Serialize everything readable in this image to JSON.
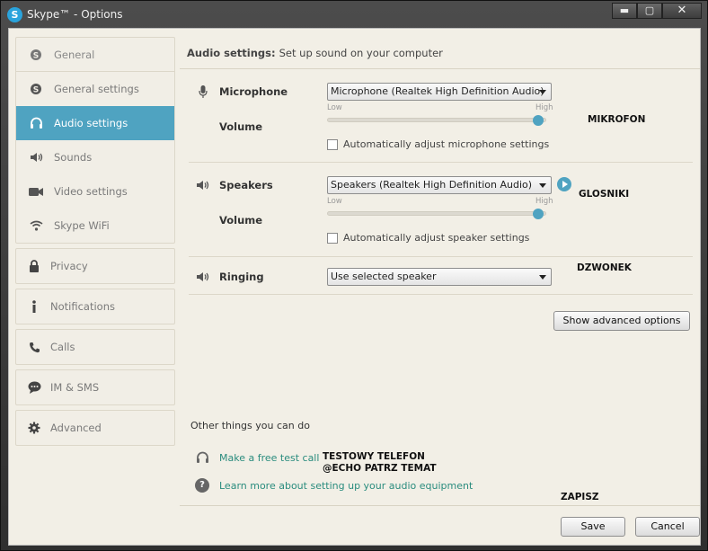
{
  "window": {
    "title": "Skype™ - Options",
    "app_icon_letter": "S",
    "minimize": "▬",
    "maximize": "▢",
    "close": "✕"
  },
  "sidebar": {
    "general_group": {
      "head": "General",
      "items": [
        {
          "label": "General settings",
          "icon": "skype-icon"
        },
        {
          "label": "Audio settings",
          "icon": "headset-icon",
          "active": true
        },
        {
          "label": "Sounds",
          "icon": "speaker-icon"
        },
        {
          "label": "Video settings",
          "icon": "camera-icon"
        },
        {
          "label": "Skype WiFi",
          "icon": "wifi-icon"
        }
      ]
    },
    "privacy": "Privacy",
    "notifications": "Notifications",
    "calls": "Calls",
    "im_sms": "IM & SMS",
    "advanced": "Advanced"
  },
  "main": {
    "header_bold": "Audio settings:",
    "header_text": "Set up sound on your computer",
    "microphone": {
      "label": "Microphone",
      "device": "Microphone (Realtek High Definition Audio)",
      "volume_label": "Volume",
      "low": "Low",
      "high": "High",
      "volume_level": 0.98,
      "auto_adjust": "Automatically adjust microphone settings",
      "annotation": "MIKROFON"
    },
    "speakers": {
      "label": "Speakers",
      "device": "Speakers (Realtek High Definition Audio)",
      "volume_label": "Volume",
      "low": "Low",
      "high": "High",
      "volume_level": 0.98,
      "auto_adjust": "Automatically adjust speaker settings",
      "annotation": "GLOSNIKI"
    },
    "ringing": {
      "label": "Ringing",
      "device": "Use selected speaker",
      "annotation": "DZWONEK"
    },
    "advanced_button": "Show advanced options",
    "other_title": "Other things you can do",
    "test_call_link": "Make a free test call",
    "test_annotation_1": "TESTOWY TELEFON",
    "test_annotation_2": "@ECHO PATRZ TEMAT",
    "learn_more_link": "Learn more about setting up your audio equipment",
    "save_annotation": "ZAPISZ"
  },
  "footer": {
    "save": "Save",
    "cancel": "Cancel"
  },
  "colors": {
    "accent": "#4fa3c1",
    "link": "#2a8c7e",
    "panel_bg": "#f2efe6"
  }
}
